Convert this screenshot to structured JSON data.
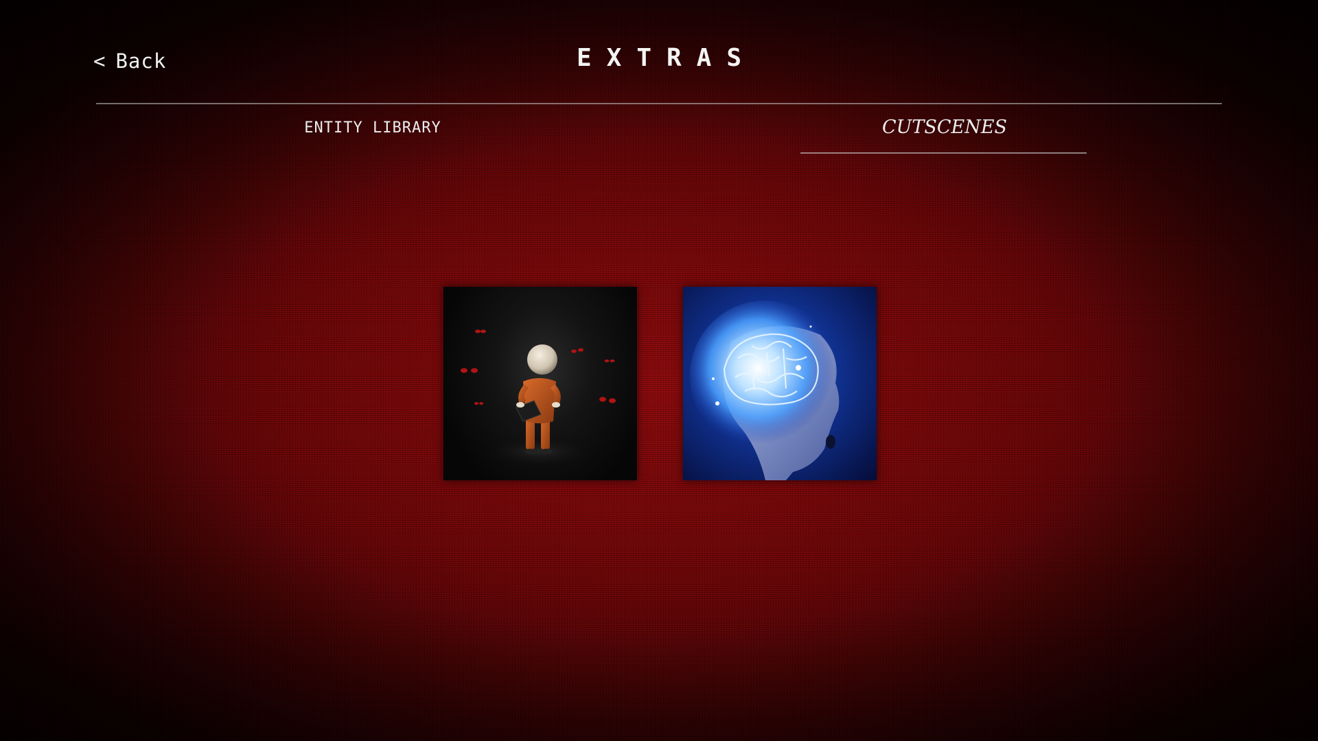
{
  "header": {
    "back_chevron": "<",
    "back_label": "Back",
    "title": "EXTRAS"
  },
  "tabs": [
    {
      "label": "ENTITY LIBRARY",
      "selected": false
    },
    {
      "label": "CUTSCENES",
      "selected": true
    }
  ],
  "cutscenes": [
    {
      "thumbnail": "figure-surrounded-by-red-eyes"
    },
    {
      "thumbnail": "glowing-blue-brain-head"
    }
  ],
  "colors": {
    "background_center": "#8a0a0c",
    "background_edge": "#0b0000",
    "text": "#f2f2f2",
    "divider": "#bdbdbd"
  }
}
